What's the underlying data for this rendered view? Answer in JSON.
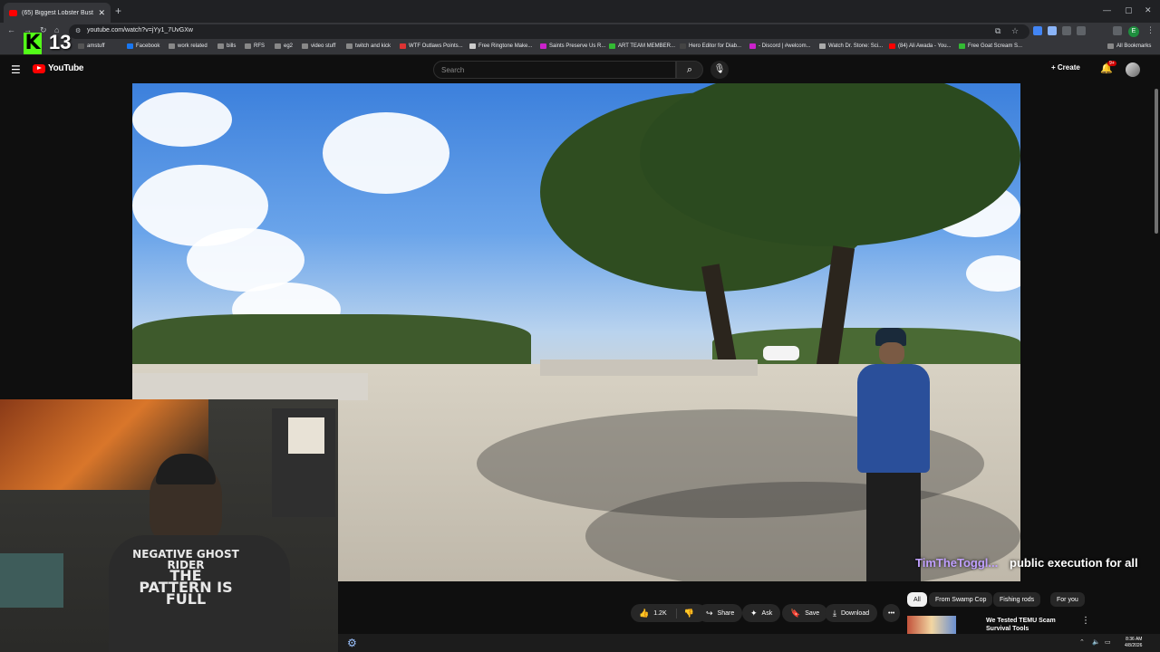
{
  "browser": {
    "tab_title": "(65) Biggest Lobster Bust I...",
    "url": "youtube.com/watch?v=jYy1_7UvGXw",
    "bookmarks": [
      {
        "label": "amstuff",
        "color": "#555"
      },
      {
        "label": "Facebook",
        "color": "#1877f2"
      },
      {
        "label": "work related",
        "color": "#888"
      },
      {
        "label": "bills",
        "color": "#888"
      },
      {
        "label": "RFS",
        "color": "#888"
      },
      {
        "label": "eg2",
        "color": "#888"
      },
      {
        "label": "video stuff",
        "color": "#888"
      },
      {
        "label": "twitch and kick",
        "color": "#888"
      },
      {
        "label": "WTF Outlaws Points...",
        "color": "#d33"
      },
      {
        "label": "Free Ringtone Make...",
        "color": "#ccc"
      },
      {
        "label": "Saints Preserve Us R...",
        "color": "#c2c"
      },
      {
        "label": "ART TEAM MEMBER...",
        "color": "#3b3"
      },
      {
        "label": "Hero Editor for Diab...",
        "color": "#444"
      },
      {
        "label": "- Discord | #welcom...",
        "color": "#c2c"
      },
      {
        "label": "Watch Dr. Stone: Sci...",
        "color": "#aaa"
      },
      {
        "label": "(84) Ali Awada - You...",
        "color": "#f00"
      },
      {
        "label": "Free Goat Scream S...",
        "color": "#3b3"
      }
    ],
    "all_bookmarks": "All Bookmarks",
    "profile_initial": "E"
  },
  "overlay": {
    "logo_letter": "K",
    "count": "13"
  },
  "youtube": {
    "wordmark": "YouTube",
    "search_placeholder": "Search",
    "create_label": "Create",
    "notif_badge": "9+"
  },
  "video": {
    "chat_user": "TimTheToggl...",
    "chat_message": "public execution for all"
  },
  "actions": {
    "like_count": "1.2K",
    "share": "Share",
    "ask": "Ask",
    "save": "Save",
    "download": "Download",
    "more": "•••"
  },
  "chips": [
    "All",
    "From Swamp Cop",
    "Fishing rods",
    "For you"
  ],
  "recommendation": {
    "title": "We Tested TEMU Scam Survival Tools"
  },
  "taskbar": {
    "time": "8:36 AM",
    "date": "4/8/2026"
  }
}
